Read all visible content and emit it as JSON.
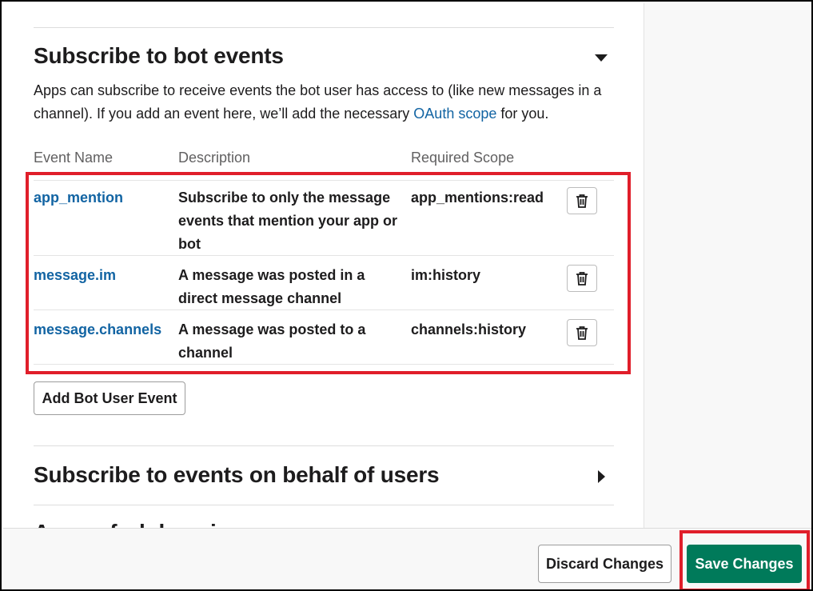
{
  "bot_events": {
    "title": "Subscribe to bot events",
    "description_before_link": "Apps can subscribe to receive events the bot user has access to (like new messages in a channel). If you add an event here, we’ll add the necessary ",
    "description_link": "OAuth scope",
    "description_after_link": " for you.",
    "columns": [
      "Event Name",
      "Description",
      "Required Scope"
    ],
    "events": [
      {
        "name": "app_mention",
        "description": "Subscribe to only the message events that mention your app or bot",
        "scope": "app_mentions:read"
      },
      {
        "name": "message.im",
        "description": "A message was posted in a direct message channel",
        "scope": "im:history"
      },
      {
        "name": "message.channels",
        "description": "A message was posted to a channel",
        "scope": "channels:history"
      }
    ],
    "add_button": "Add Bot User Event"
  },
  "user_events": {
    "title": "Subscribe to events on behalf of users"
  },
  "app_unfurl": {
    "title": "App unfurl domains"
  },
  "footer": {
    "discard_label": "Discard Changes",
    "save_label": "Save Changes"
  },
  "colors": {
    "link": "#1264a3",
    "primary": "#007a5a",
    "highlight": "#e01e2a"
  },
  "icons": {
    "collapse": "caret-down-icon",
    "expand": "caret-right-icon",
    "delete": "trash-icon"
  }
}
